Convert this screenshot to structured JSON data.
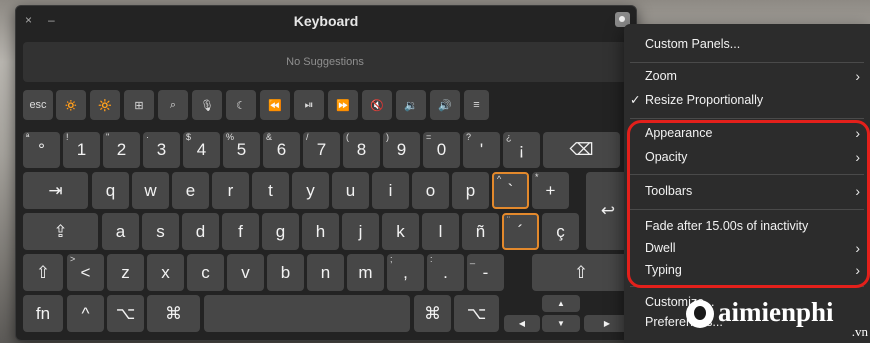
{
  "window": {
    "title": "Keyboard",
    "close_glyph": "×",
    "minimize_glyph": "–"
  },
  "suggestions": {
    "text": "No Suggestions"
  },
  "function_row": [
    {
      "name": "esc-key",
      "label": "esc"
    },
    {
      "name": "brightness-down-key",
      "label": "🔅"
    },
    {
      "name": "brightness-up-key",
      "label": "🔆"
    },
    {
      "name": "mission-control-key",
      "label": "⊞"
    },
    {
      "name": "spotlight-key",
      "label": "⌕"
    },
    {
      "name": "dictation-key",
      "label": "🎙"
    },
    {
      "name": "do-not-disturb-key",
      "label": "☾"
    },
    {
      "name": "rewind-key",
      "label": "⏪"
    },
    {
      "name": "play-pause-key",
      "label": "⏯"
    },
    {
      "name": "fast-forward-key",
      "label": "⏩"
    },
    {
      "name": "mute-key",
      "label": "🔇"
    },
    {
      "name": "volume-down-key",
      "label": "🔉"
    },
    {
      "name": "volume-up-key",
      "label": "🔊"
    },
    {
      "name": "list-key",
      "label": "≡"
    }
  ],
  "number_row": [
    {
      "name": "key-degree",
      "label": "°",
      "alt": "ª"
    },
    {
      "name": "key-1",
      "label": "1",
      "alt": "!"
    },
    {
      "name": "key-2",
      "label": "2",
      "alt": "\""
    },
    {
      "name": "key-3",
      "label": "3",
      "alt": "·"
    },
    {
      "name": "key-4",
      "label": "4",
      "alt": "$"
    },
    {
      "name": "key-5",
      "label": "5",
      "alt": "%"
    },
    {
      "name": "key-6",
      "label": "6",
      "alt": "&"
    },
    {
      "name": "key-7",
      "label": "7",
      "alt": "/"
    },
    {
      "name": "key-8",
      "label": "8",
      "alt": "("
    },
    {
      "name": "key-9",
      "label": "9",
      "alt": ")"
    },
    {
      "name": "key-0",
      "label": "0",
      "alt": "="
    },
    {
      "name": "key-apostrophe",
      "label": "'",
      "alt": "?"
    },
    {
      "name": "key-inverted-exclamation",
      "label": "¡",
      "alt": "¿"
    },
    {
      "name": "backspace-key",
      "label": "⌫",
      "alt": ""
    }
  ],
  "row_q": [
    {
      "name": "tab-key",
      "label": "⇥"
    },
    {
      "name": "key-q",
      "label": "q"
    },
    {
      "name": "key-w",
      "label": "w"
    },
    {
      "name": "key-e",
      "label": "e"
    },
    {
      "name": "key-r",
      "label": "r"
    },
    {
      "name": "key-t",
      "label": "t"
    },
    {
      "name": "key-y",
      "label": "y"
    },
    {
      "name": "key-u",
      "label": "u"
    },
    {
      "name": "key-i",
      "label": "i"
    },
    {
      "name": "key-o",
      "label": "o"
    },
    {
      "name": "key-p",
      "label": "p"
    },
    {
      "name": "key-grave-dead",
      "label": "`",
      "alt": "^"
    },
    {
      "name": "key-plus",
      "label": "+",
      "alt": "*"
    }
  ],
  "return_key": {
    "label": "↩"
  },
  "row_a": [
    {
      "name": "caps-lock-key",
      "label": "⇪"
    },
    {
      "name": "key-a",
      "label": "a"
    },
    {
      "name": "key-s",
      "label": "s"
    },
    {
      "name": "key-d",
      "label": "d"
    },
    {
      "name": "key-f",
      "label": "f"
    },
    {
      "name": "key-g",
      "label": "g"
    },
    {
      "name": "key-h",
      "label": "h"
    },
    {
      "name": "key-j",
      "label": "j"
    },
    {
      "name": "key-k",
      "label": "k"
    },
    {
      "name": "key-l",
      "label": "l"
    },
    {
      "name": "key-n-tilde",
      "label": "ñ"
    },
    {
      "name": "key-acute-dead",
      "label": "´",
      "alt": "¨"
    },
    {
      "name": "key-c-cedilla",
      "label": "ç"
    }
  ],
  "row_z": [
    {
      "name": "left-shift-key",
      "label": "⇧"
    },
    {
      "name": "key-less-than",
      "label": "<",
      "alt": ">"
    },
    {
      "name": "key-z",
      "label": "z"
    },
    {
      "name": "key-x",
      "label": "x"
    },
    {
      "name": "key-c",
      "label": "c"
    },
    {
      "name": "key-v",
      "label": "v"
    },
    {
      "name": "key-b",
      "label": "b"
    },
    {
      "name": "key-n",
      "label": "n"
    },
    {
      "name": "key-m",
      "label": "m"
    },
    {
      "name": "key-comma",
      "label": ",",
      "alt": ";"
    },
    {
      "name": "key-period",
      "label": ".",
      "alt": ":"
    },
    {
      "name": "key-minus",
      "label": "-",
      "alt": "_"
    },
    {
      "name": "right-shift-key",
      "label": "⇧"
    }
  ],
  "row_bottom": [
    {
      "name": "fn-key",
      "label": "fn"
    },
    {
      "name": "control-key",
      "label": "^"
    },
    {
      "name": "left-option-key",
      "label": "⌥"
    },
    {
      "name": "left-command-key",
      "label": "⌘"
    },
    {
      "name": "space-key",
      "label": ""
    },
    {
      "name": "right-command-key",
      "label": "⌘"
    },
    {
      "name": "right-option-key",
      "label": "⌥"
    }
  ],
  "arrows": {
    "up": "▲",
    "left": "◀",
    "down": "▼",
    "right": "▶"
  },
  "menu": {
    "custom_panels": "Custom Panels...",
    "zoom": "Zoom",
    "resize_proportionally": "Resize Proportionally",
    "resize_check": "✓",
    "appearance": "Appearance",
    "opacity": "Opacity",
    "toolbars": "Toolbars",
    "fade": "Fade after 15.00s of inactivity",
    "dwell": "Dwell",
    "typing": "Typing",
    "customize": "Customize...",
    "preferences": "Preferences...",
    "chevron": "›"
  },
  "watermark": {
    "text": "aimienphi",
    "suffix": ".vn"
  },
  "colors": {
    "key": "#474747",
    "window": "#232323",
    "menu": "#2c2c2c",
    "accent_orange": "#e3892c",
    "highlight_red": "#e3201b"
  }
}
